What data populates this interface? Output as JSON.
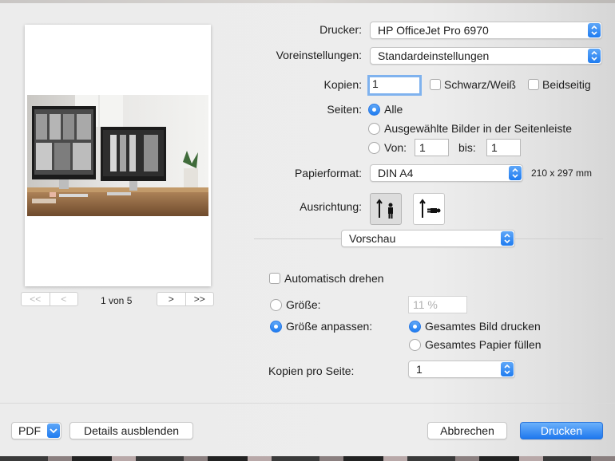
{
  "printer": {
    "label": "Drucker:",
    "value": "HP OfficeJet Pro 6970"
  },
  "presets": {
    "label": "Voreinstellungen:",
    "value": "Standardeinstellungen"
  },
  "copies": {
    "label": "Kopien:",
    "value": "1",
    "bw_label": "Schwarz/Weiß",
    "duplex_label": "Beidseitig"
  },
  "pages": {
    "label": "Seiten:",
    "all": "Alle",
    "selected": "Ausgewählte Bilder in der Seitenleiste",
    "from_label": "Von:",
    "from_value": "1",
    "to_label": "bis:",
    "to_value": "1"
  },
  "paper": {
    "label": "Papierformat:",
    "value": "DIN A4",
    "size": "210 x 297 mm"
  },
  "orientation": {
    "label": "Ausrichtung:"
  },
  "section_popup": {
    "value": "Vorschau"
  },
  "auto_rotate": {
    "label": "Automatisch drehen"
  },
  "size": {
    "label": "Größe:",
    "value": "11 %",
    "fit_label": "Größe anpassen:",
    "print_entire": "Gesamtes Bild drucken",
    "fill_paper": "Gesamtes Papier füllen"
  },
  "copies_per_page": {
    "label": "Kopien pro Seite:",
    "value": "1"
  },
  "preview": {
    "page_indicator": "1 von 5",
    "first": "<<",
    "prev": "<",
    "next": ">",
    "last": ">>"
  },
  "footer": {
    "pdf": "PDF",
    "details": "Details ausblenden",
    "cancel": "Abbrechen",
    "print": "Drucken"
  },
  "colors": {
    "accent": "#1f7cf0",
    "dialog_bg": "#ececec"
  }
}
